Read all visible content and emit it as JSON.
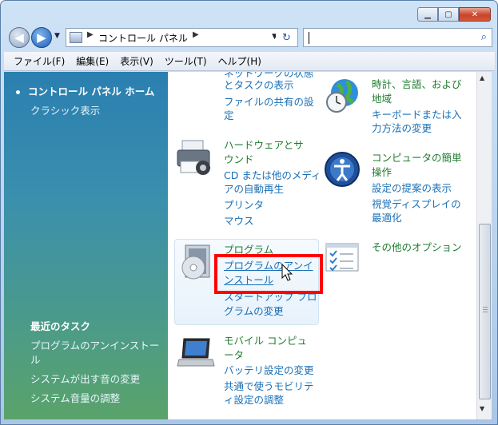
{
  "window": {
    "caption_buttons": [
      "minimize-icon",
      "maximize-icon",
      "close-icon"
    ]
  },
  "address": {
    "crumb": "コントロール パネル",
    "search_placeholder": ""
  },
  "menubar": {
    "items": [
      "ファイル(F)",
      "編集(E)",
      "表示(V)",
      "ツール(T)",
      "ヘルプ(H)"
    ]
  },
  "sidebar": {
    "current": "コントロール パネル ホーム",
    "classic": "クラシック表示",
    "recent_heading": "最近のタスク",
    "recent_items": [
      "プログラムのアンインストー",
      "ル",
      "システムが出す音の変更",
      "システム音量の調整"
    ]
  },
  "content": {
    "network_partial": "ネットワークの状態",
    "network_tasks": "とタスクの表示",
    "network_sharing1": "ファイルの共有の設",
    "network_sharing2": "定",
    "clock_title1": "時計、言語、および",
    "clock_title2": "地域",
    "clock_link1": "キーボードまたは入",
    "clock_link2": "力方法の変更",
    "hardware_title1": "ハードウェアとサ",
    "hardware_title2": "ウンド",
    "hardware_link1": "CD または他のメディ",
    "hardware_link2": "アの自動再生",
    "hardware_link3": "プリンタ",
    "hardware_link4": "マウス",
    "ease_title1": "コンピュータの簡単",
    "ease_title2": "操作",
    "ease_link1": "設定の提案の表示",
    "ease_link2": "視覚ディスプレイの",
    "ease_link3": "最適化",
    "programs_title": "プログラム",
    "programs_link1": "プログラムのアンイ",
    "programs_link2": "ンストール",
    "programs_link3": "スタートアップ プロ",
    "programs_link4": "グラムの変更",
    "other_title": "その他のオプション",
    "mobile_title1": "モバイル コンピュ",
    "mobile_title2": "ータ",
    "mobile_link1": "バッテリ設定の変更",
    "mobile_link2": "共通で使うモビリテ",
    "mobile_link3": "ィ設定の調整"
  },
  "colors": {
    "link": "#1a6fb5",
    "category_title": "#1f7a2e",
    "highlight": "#ff0000"
  }
}
